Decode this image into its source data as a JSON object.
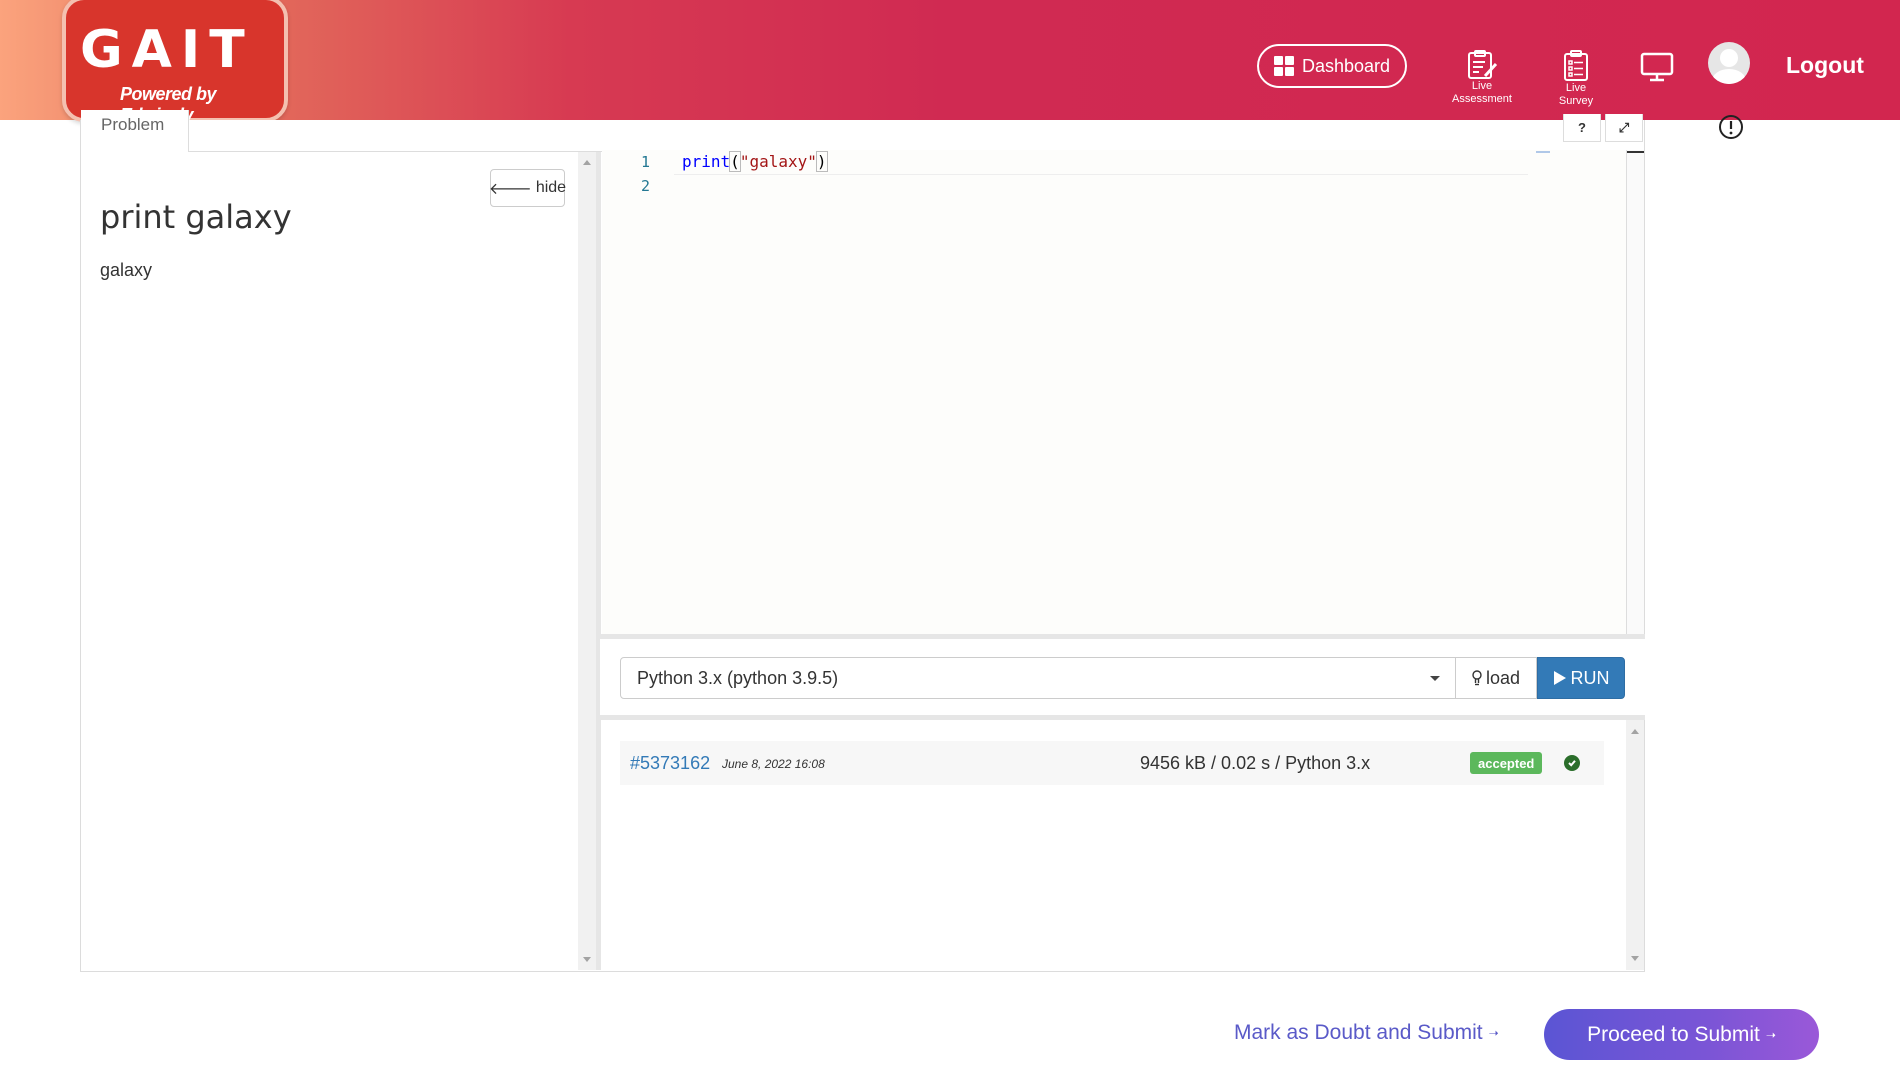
{
  "header": {
    "logo_main": "GAIT",
    "logo_sub": "Powered by Edwisely",
    "dashboard_label": "Dashboard",
    "live_assessment_line1": "Live",
    "live_assessment_line2": "Assessment",
    "live_survey_line1": "Live",
    "live_survey_line2": "Survey",
    "logout_label": "Logout"
  },
  "tabs": {
    "problem_label": "Problem",
    "help_label": "?",
    "expand_label": "⤢"
  },
  "problem": {
    "hide_label": "hide",
    "title": "print galaxy",
    "text": "galaxy"
  },
  "editor": {
    "line_numbers": [
      "1",
      "2"
    ],
    "code_keyword": "print",
    "code_open": "(",
    "code_string": "\"galaxy\"",
    "code_close": ")"
  },
  "run_bar": {
    "language": "Python 3.x (python 3.9.5)",
    "load_label": "load",
    "run_label": "RUN"
  },
  "submission": {
    "id": "#5373162",
    "date": "June 8, 2022 16:08",
    "stats": "9456 kB / 0.02 s / Python 3.x",
    "status": "accepted"
  },
  "footer": {
    "doubt_label": "Mark as Doubt and Submit",
    "proceed_label": "Proceed to Submit"
  },
  "colors": {
    "header_primary": "#d2264f",
    "run_button": "#337ab7",
    "accepted": "#5cb85c",
    "proceed_gradient_start": "#5b55d4",
    "proceed_gradient_end": "#9a58d8"
  }
}
